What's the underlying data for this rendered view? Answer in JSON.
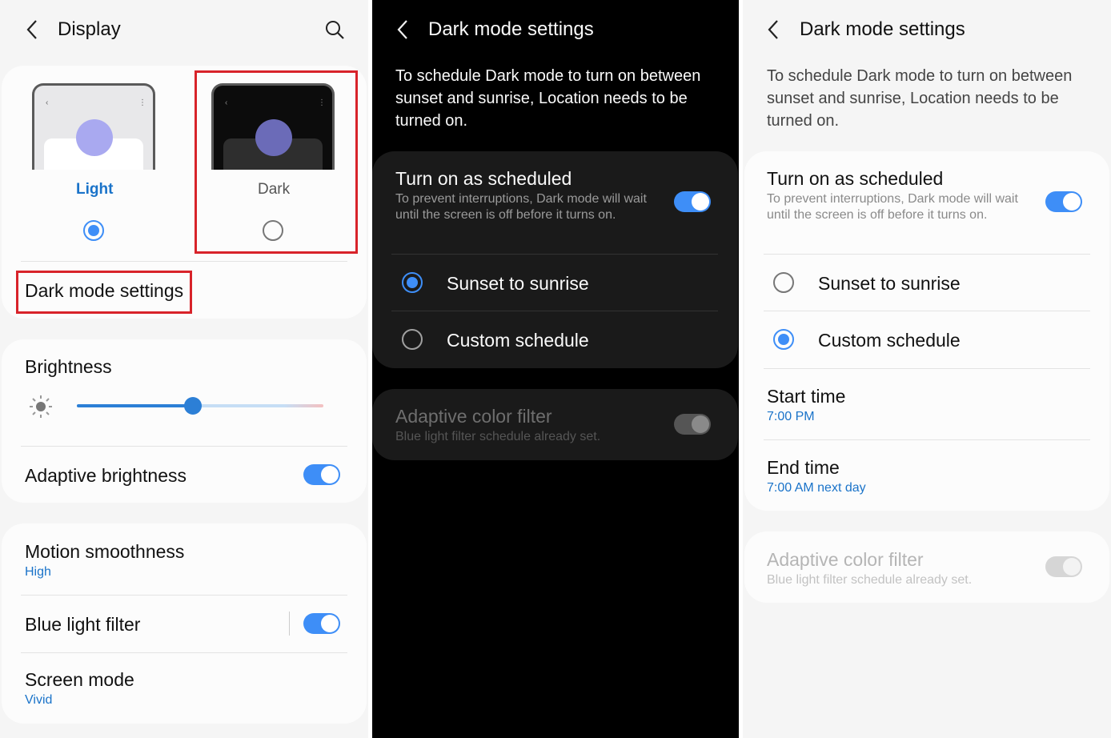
{
  "display": {
    "title": "Display",
    "theme_light_label": "Light",
    "theme_dark_label": "Dark",
    "dark_mode_settings": "Dark mode settings",
    "brightness_label": "Brightness",
    "brightness_level": 0.47,
    "adaptive_brightness": "Adaptive brightness",
    "motion_smoothness": "Motion smoothness",
    "motion_smoothness_value": "High",
    "blue_light_filter": "Blue light filter",
    "screen_mode": "Screen mode",
    "screen_mode_value": "Vivid"
  },
  "dark_settings": {
    "title": "Dark mode settings",
    "description": "To schedule Dark mode to turn on between sunset and sunrise, Location needs to be turned on.",
    "turn_on_scheduled": "Turn on as scheduled",
    "turn_on_scheduled_sub": "To prevent interruptions, Dark mode will wait until the screen is off before it turns on.",
    "sunset_to_sunrise": "Sunset to sunrise",
    "custom_schedule": "Custom schedule",
    "adaptive_color_filter": "Adaptive color filter",
    "adaptive_color_filter_sub": "Blue light filter schedule already set."
  },
  "light_settings": {
    "title": "Dark mode settings",
    "description": "To schedule Dark mode to turn on between sunset and sunrise, Location needs to be turned on.",
    "turn_on_scheduled": "Turn on as scheduled",
    "turn_on_scheduled_sub": "To prevent interruptions, Dark mode will wait until the screen is off before it turns on.",
    "sunset_to_sunrise": "Sunset to sunrise",
    "custom_schedule": "Custom schedule",
    "start_time": "Start time",
    "start_time_value": "7:00 PM",
    "end_time": "End time",
    "end_time_value": "7:00 AM next day",
    "adaptive_color_filter": "Adaptive color filter",
    "adaptive_color_filter_sub": "Blue light filter schedule already set."
  },
  "colors": {
    "accent": "#3e8ef7",
    "link_blue": "#1a73c9",
    "highlight_red": "#d8232a"
  }
}
